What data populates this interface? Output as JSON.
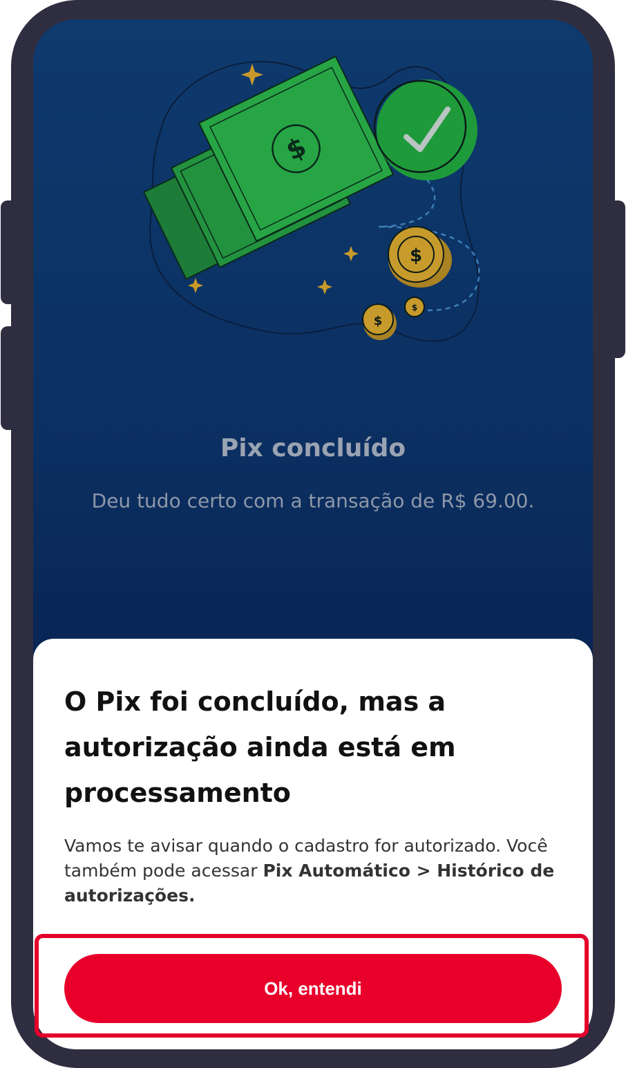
{
  "success": {
    "title": "Pix concluído",
    "subtitle": "Deu tudo certo com a transação de R$ 69.00."
  },
  "sheet": {
    "title": "O Pix foi concluído, mas a autorização ainda está em processamento",
    "body_text": "Vamos te avisar quando o cadastro for autorizado. Você também pode acessar",
    "body_bold": "Pix Automático > Histórico de autorizações."
  },
  "button": {
    "label": "Ok, entendi"
  },
  "colors": {
    "primary": "#e8002b",
    "background_top": "#0e3a6e",
    "background_bottom": "#061e4a",
    "money_green": "#1f9a3b",
    "coin_gold": "#c79a2c"
  },
  "icons": [
    "money-bills-illustration",
    "check-circle-icon",
    "coin-icon",
    "sparkle-icon"
  ]
}
